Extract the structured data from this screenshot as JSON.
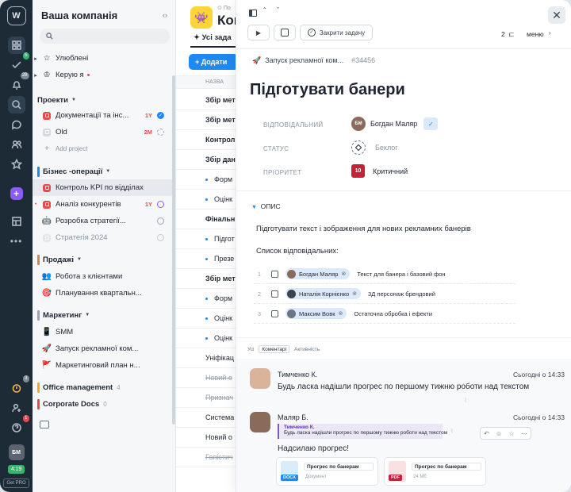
{
  "rail": {
    "badges": {
      "tasks": "5",
      "notifications": "28",
      "timer": "3",
      "help": "1"
    },
    "time": "4:19",
    "plan": "Get PRO"
  },
  "sidebar": {
    "company": "Ваша компанія",
    "favorites": "Улюблені",
    "managed": "Керую я",
    "projects": {
      "title": "Проекти",
      "items": [
        {
          "label": "Документації та інс...",
          "tag": "1Y"
        },
        {
          "label": "Old",
          "tag": "2M"
        }
      ],
      "add": "Add project"
    },
    "business": {
      "title": "Бізнес -операції",
      "items": [
        {
          "label": "Контроль KPI по відділах"
        },
        {
          "label": "Аналіз конкурентів",
          "tag": "1Y"
        },
        {
          "label": "Розробка стратегії..."
        },
        {
          "label": "Стратегія 2024"
        }
      ]
    },
    "sales": {
      "title": "Продажі",
      "items": [
        {
          "label": "Робота з клієнтами"
        },
        {
          "label": "Планування квартальн..."
        }
      ]
    },
    "marketing": {
      "title": "Маркетинг",
      "items": [
        {
          "label": "SMM"
        },
        {
          "label": "Запуск рекламної ком..."
        },
        {
          "label": "Маркетинговий план н..."
        }
      ]
    },
    "office": {
      "title": "Office management",
      "count": "4"
    },
    "docs": {
      "title": "Corporate Docs",
      "count": "0"
    }
  },
  "middle": {
    "crumb": "По",
    "title": "Конт",
    "tab": "Усі зада",
    "add": "Додати",
    "col": "НАЗВА",
    "rows": [
      {
        "t": "Збір мет",
        "k": "b"
      },
      {
        "t": "Збір мет",
        "k": "b"
      },
      {
        "t": "Контрол",
        "k": "b"
      },
      {
        "t": "Збір дан",
        "k": "b"
      },
      {
        "t": "Форм",
        "k": "s"
      },
      {
        "t": "Оцінк",
        "k": "s"
      },
      {
        "t": "Фінальн",
        "k": "b"
      },
      {
        "t": "Підгот",
        "k": "s"
      },
      {
        "t": "Презе",
        "k": "s"
      },
      {
        "t": "Збір мет",
        "k": "b"
      },
      {
        "t": "Форм",
        "k": "s"
      },
      {
        "t": "Оцінк",
        "k": "s"
      },
      {
        "t": "Оцінк",
        "k": "s"
      },
      {
        "t": "Уніфікац",
        "k": "n"
      },
      {
        "t": "Новий о",
        "k": "x"
      },
      {
        "t": "Признач",
        "k": "x"
      },
      {
        "t": "Система",
        "k": "n"
      },
      {
        "t": "Новий о",
        "k": "n"
      },
      {
        "t": "Голістич",
        "k": "x"
      }
    ]
  },
  "panel": {
    "close_task": "Закрити задачу",
    "count": "2",
    "menu": "меню",
    "breadcrumb": "Запуск рекламної ком...",
    "task_id": "#34456",
    "title": "Підготувати банери",
    "labels": {
      "assignee": "ВІДПОВІДАЛЬНИЙ",
      "status": "СТАТУС",
      "priority": "ПРІОРИТЕТ"
    },
    "assignee": {
      "name": "Богдан Маляр",
      "initials": "БМ"
    },
    "status": "Беклог",
    "priority": {
      "value": "10",
      "label": "Критичний"
    },
    "description": {
      "title": "ОПИС",
      "text": "Підготувати текст і зображення для нових рекламних банерів",
      "list_title": "Список відповідальних:",
      "items": [
        {
          "n": "1",
          "person": "Богдан Маляр",
          "task": "Текст для банера і базовий фон"
        },
        {
          "n": "2",
          "person": "Наталія Корнієнко",
          "task": "3Д персонаж брендовий"
        },
        {
          "n": "3",
          "person": "Максим Вовк",
          "task": "Остаточна обробка і ефекти"
        }
      ]
    },
    "comment_tabs": [
      "Усі",
      "Коментарі",
      "Активність"
    ],
    "comments": [
      {
        "author": "Тимченко К.",
        "time": "Сьогодні о 14:33",
        "text": "Будь ласка надішли прогрес по першому тижню роботи над текстом"
      },
      {
        "author": "Маляр Б.",
        "time": "Сьогодні о 14:33",
        "quote_author": "Тимченко К.",
        "quote_text": "Будь ласка надішли прогрес по першому тижню роботи над текстом",
        "text": "Надсилаю прогрес!"
      }
    ],
    "attachments": [
      {
        "name": "Прогрес по банерам",
        "kind": "DOCX",
        "meta": "Документ"
      },
      {
        "name": "Прогрес по банерам",
        "kind": "PDF",
        "meta": "24 Мб"
      }
    ]
  }
}
